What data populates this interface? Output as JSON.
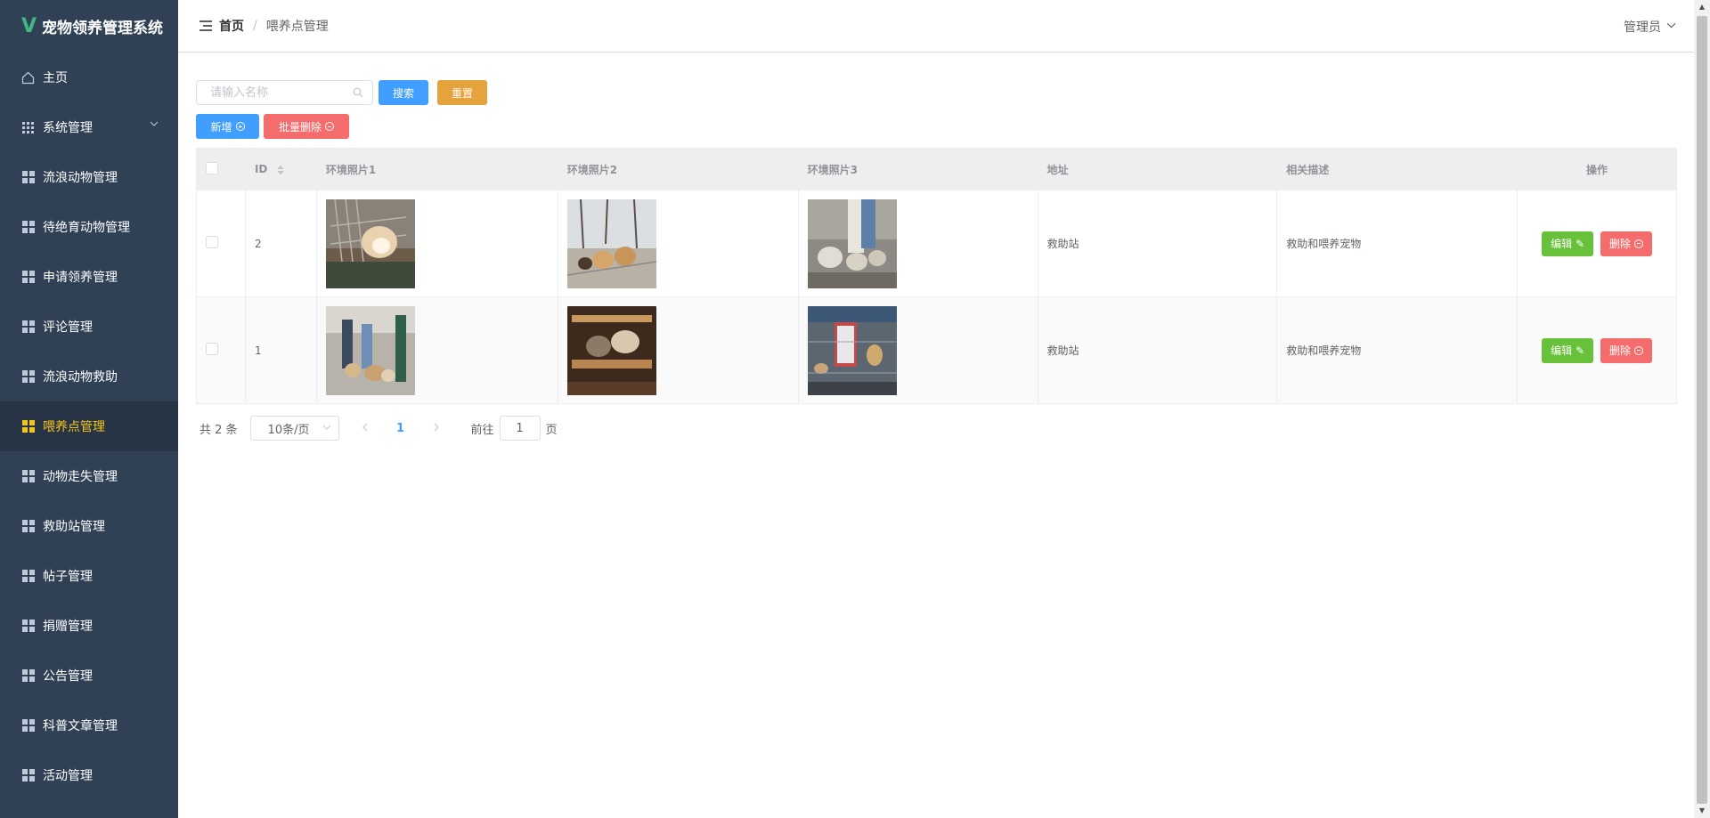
{
  "app": {
    "title": "宠物领养管理系统"
  },
  "sidebar": {
    "items": [
      {
        "label": "主页",
        "icon": "home-icon"
      },
      {
        "label": "系统管理",
        "icon": "grid-icon",
        "expandable": true
      },
      {
        "label": "流浪动物管理",
        "icon": "grid-icon"
      },
      {
        "label": "待绝育动物管理",
        "icon": "grid-icon"
      },
      {
        "label": "申请领养管理",
        "icon": "grid-icon"
      },
      {
        "label": "评论管理",
        "icon": "grid-icon"
      },
      {
        "label": "流浪动物救助",
        "icon": "grid-icon"
      },
      {
        "label": "喂养点管理",
        "icon": "grid-icon",
        "active": true
      },
      {
        "label": "动物走失管理",
        "icon": "grid-icon"
      },
      {
        "label": "救助站管理",
        "icon": "grid-icon"
      },
      {
        "label": "帖子管理",
        "icon": "grid-icon"
      },
      {
        "label": "捐赠管理",
        "icon": "grid-icon"
      },
      {
        "label": "公告管理",
        "icon": "grid-icon"
      },
      {
        "label": "科普文章管理",
        "icon": "grid-icon"
      },
      {
        "label": "活动管理",
        "icon": "grid-icon"
      }
    ]
  },
  "header": {
    "breadcrumb": {
      "home": "首页",
      "separator": "/",
      "current": "喂养点管理"
    },
    "user": "管理员"
  },
  "toolbar": {
    "search_placeholder": "请输入名称",
    "search_value": "",
    "search_label": "搜索",
    "reset_label": "重置",
    "add_label": "新增",
    "batch_delete_label": "批量删除"
  },
  "table": {
    "headers": {
      "id": "ID",
      "photo1": "环境照片1",
      "photo2": "环境照片2",
      "photo3": "环境照片3",
      "address": "地址",
      "description": "相关描述",
      "actions": "操作"
    },
    "rows": [
      {
        "id": "2",
        "address": "救助站",
        "description": "救助和喂养宠物",
        "edit": "编辑",
        "delete": "删除"
      },
      {
        "id": "1",
        "address": "救助站",
        "description": "救助和喂养宠物",
        "edit": "编辑",
        "delete": "删除"
      }
    ]
  },
  "pagination": {
    "total_text": "共 2 条",
    "page_size": "10条/页",
    "current_page": "1",
    "goto_label": "前往",
    "goto_value": "1",
    "page_suffix": "页"
  },
  "colors": {
    "sidebar_bg": "#304156",
    "active_menu": "#f5c518",
    "primary": "#409eff",
    "warning": "#e6a23c",
    "danger": "#f56c6c",
    "success": "#67c23a"
  }
}
